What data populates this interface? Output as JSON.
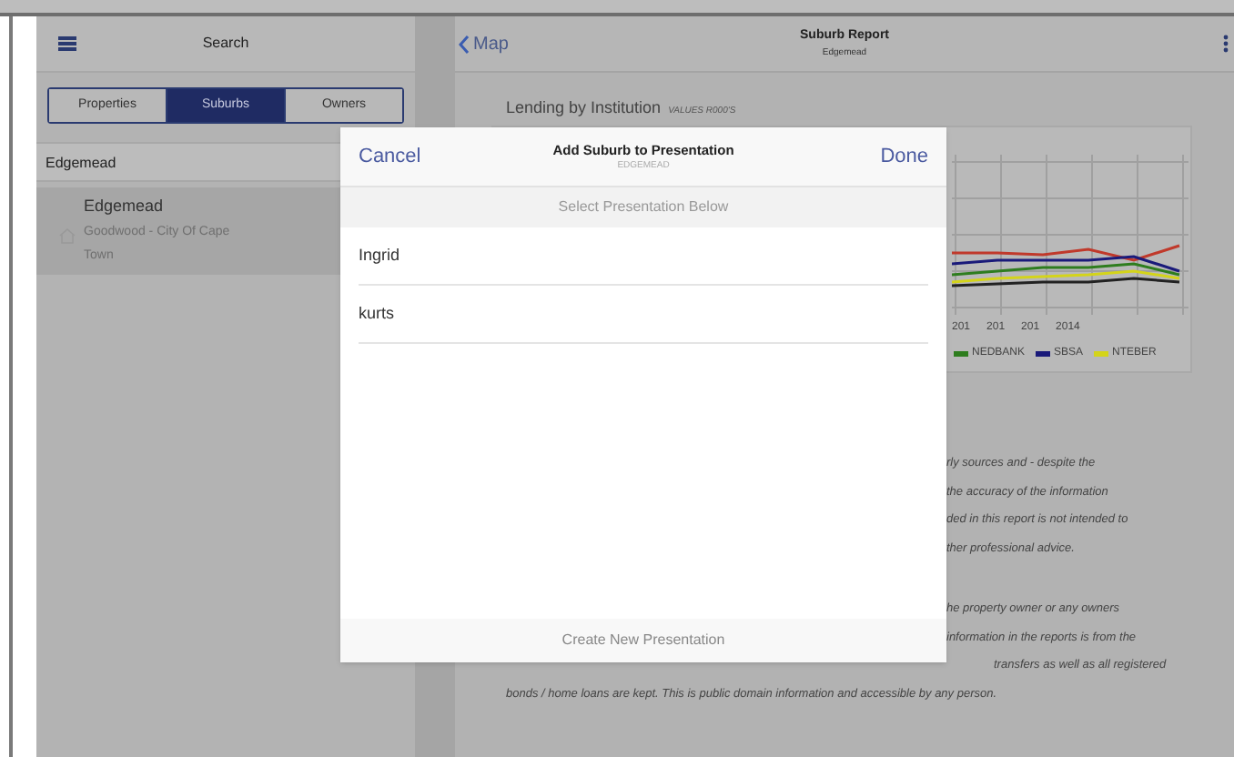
{
  "sidebar": {
    "title": "Search",
    "segments": [
      {
        "label": "Properties",
        "selected": false
      },
      {
        "label": "Suburbs",
        "selected": true
      },
      {
        "label": "Owners",
        "selected": false
      }
    ],
    "search": {
      "value": "Edgemead"
    },
    "results": [
      {
        "name": "Edgemead",
        "detail": "Goodwood - City Of Cape Town",
        "selected": true
      }
    ]
  },
  "report": {
    "back": "Map",
    "title": "Suburb Report",
    "subtitle": "Edgemead",
    "section_title": "Lending by Institution",
    "section_note": "VALUES R000'S",
    "axis_labels": [
      "201",
      "201",
      "201",
      "2014"
    ],
    "legend": [
      {
        "label": "NEDBANK",
        "color": "#2e7d1e"
      },
      {
        "label": "SBSA",
        "color": "#1a1a7a"
      },
      {
        "label": "NTEBER",
        "color": "#d4d41a"
      }
    ],
    "disclaimer": [
      "rly sources and - despite the",
      "the accuracy of the information",
      "ded in this report is not intended to",
      "ther professional advice."
    ],
    "disclaimer2": [
      "he property owner or any owners",
      "information in the reports is from the",
      "transfers as well as all registered",
      "bonds / home loans are kept. This is public domain information and accessible by any person."
    ]
  },
  "modal": {
    "cancel": "Cancel",
    "title": "Add Suburb to Presentation",
    "subtitle": "EDGEMEAD",
    "done": "Done",
    "prompt": "Select Presentation Below",
    "items": [
      {
        "label": "Ingrid"
      },
      {
        "label": "kurts"
      }
    ],
    "footer": "Create New Presentation"
  }
}
